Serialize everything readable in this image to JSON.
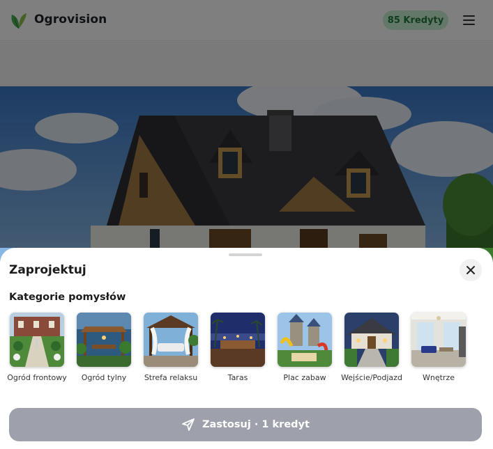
{
  "header": {
    "brand": "Ogrovision",
    "credits": "85 Kredyty"
  },
  "sheet": {
    "title": "Zaprojektuj",
    "section_title": "Kategorie pomysłów",
    "categories": [
      {
        "label": "Ogród frontowy"
      },
      {
        "label": "Ogród tylny"
      },
      {
        "label": "Strefa relaksu"
      },
      {
        "label": "Taras"
      },
      {
        "label": "Plac zabaw"
      },
      {
        "label": "Wejście/Podjazd"
      },
      {
        "label": "Wnętrze"
      }
    ],
    "apply_label": "Zastosuj · 1 kredyt"
  },
  "colors": {
    "accent_green": "#1f7a3a",
    "credits_bg": "#c9f0d2",
    "apply_button": "#9ea1ab"
  },
  "icons": [
    "leaf-logo-icon",
    "menu-icon",
    "close-icon",
    "send-icon"
  ]
}
